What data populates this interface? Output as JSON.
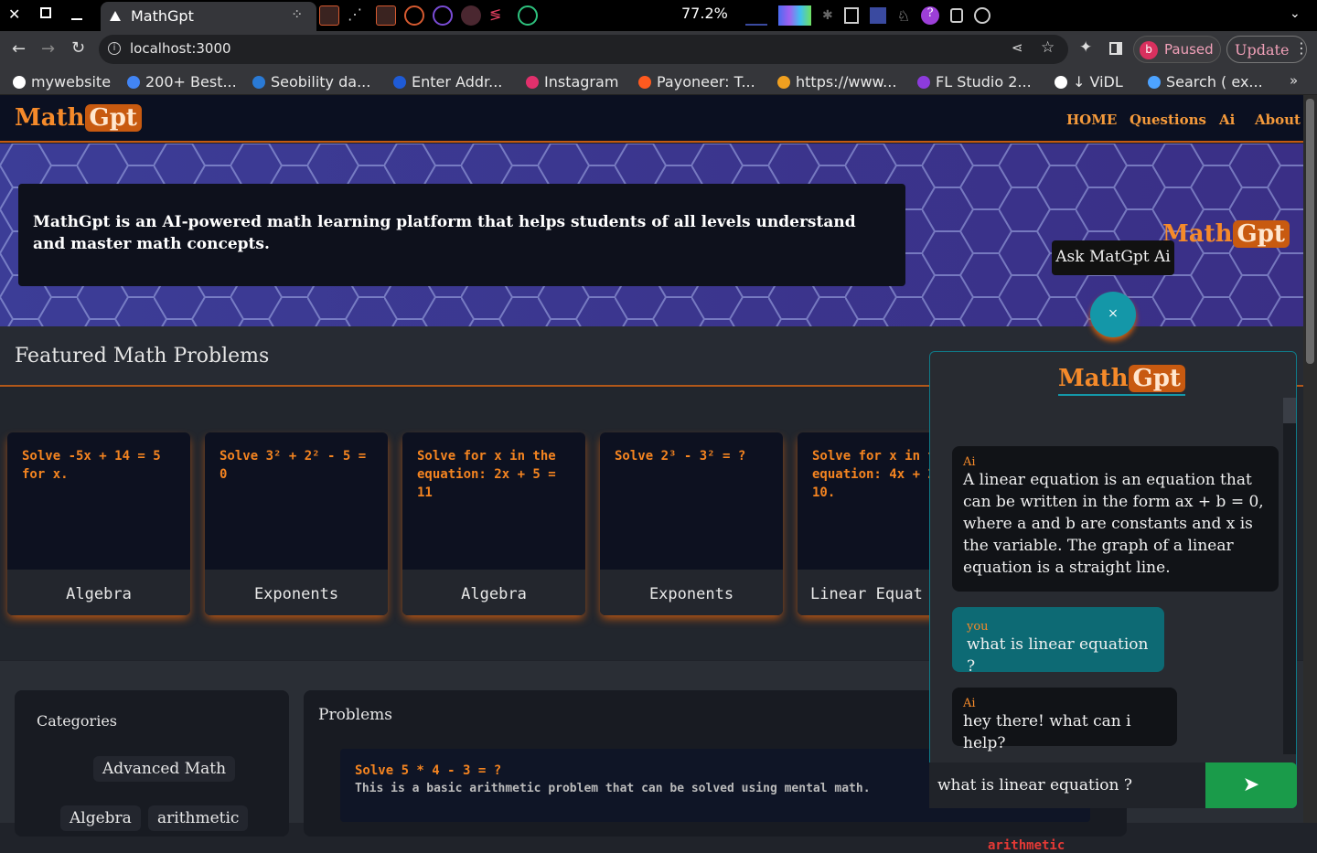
{
  "browser": {
    "tab_title": "MathGpt",
    "url": "localhost:3000",
    "cpu_readout": "77.2%",
    "profile_status": "Paused",
    "update_label": "Update",
    "bookmarks": [
      {
        "label": "mywebsite",
        "color": "#ffffff"
      },
      {
        "label": "200+ Best...",
        "color": "#4285f4"
      },
      {
        "label": "Seobility da...",
        "color": "#2a7ad5"
      },
      {
        "label": "Enter Addr...",
        "color": "#1f5bd6"
      },
      {
        "label": "Instagram",
        "color": "#e1306c"
      },
      {
        "label": "Payoneer: T...",
        "color": "#ff5a1f"
      },
      {
        "label": "https://www...",
        "color": "#f0a020"
      },
      {
        "label": "FL Studio 2...",
        "color": "#8c3bdc"
      },
      {
        "label": "↓ ViDL",
        "color": "#ffffff"
      },
      {
        "label": "Search ( ex...",
        "color": "#4da3ff"
      }
    ]
  },
  "site": {
    "logo_math": "Math",
    "logo_gpt": "Gpt",
    "nav": [
      "HOME",
      "Questions",
      "Ai",
      "About"
    ],
    "hero_text": "MathGpt is an AI-powered math learning platform that helps students of all levels understand and master math concepts.",
    "featured_title": "Featured Math Problems",
    "cards": [
      {
        "question": "Solve -5x + 14 = 5 for x.",
        "category": "Algebra"
      },
      {
        "question": "Solve 3² + 2² - 5 = 0",
        "category": "Exponents"
      },
      {
        "question": "Solve for x in the equation: 2x + 5 = 11",
        "category": "Algebra"
      },
      {
        "question": "Solve 2³ - 3² = ?",
        "category": "Exponents"
      },
      {
        "question": "Solve for x in the equation: 4x + 2 = 10.",
        "category": "Linear Equat"
      }
    ],
    "categories_title": "Categories",
    "categories": [
      "Advanced Math",
      "Algebra",
      "arithmetic"
    ],
    "problems_title": "Problems",
    "problem": {
      "title": "Solve 5 * 4 - 3 = ?",
      "description": "This is a basic arithmetic problem that can be solved using mental math.",
      "tag": "arithmetic"
    }
  },
  "chat": {
    "tooltip": "Ask MatGpt Ai",
    "close_symbol": "×",
    "logo_math": "Math",
    "logo_gpt": "Gpt",
    "messages": [
      {
        "sender": "Ai",
        "text": "A linear equation is an equation that can be written in the form ax + b = 0, where a and b are constants and x is the variable. The graph of a linear equation is a straight line."
      },
      {
        "sender": "you",
        "text": "what is linear equation ?"
      },
      {
        "sender": "Ai",
        "text": "hey there! what can i help?"
      }
    ],
    "input_value": "what is linear equation ?"
  }
}
